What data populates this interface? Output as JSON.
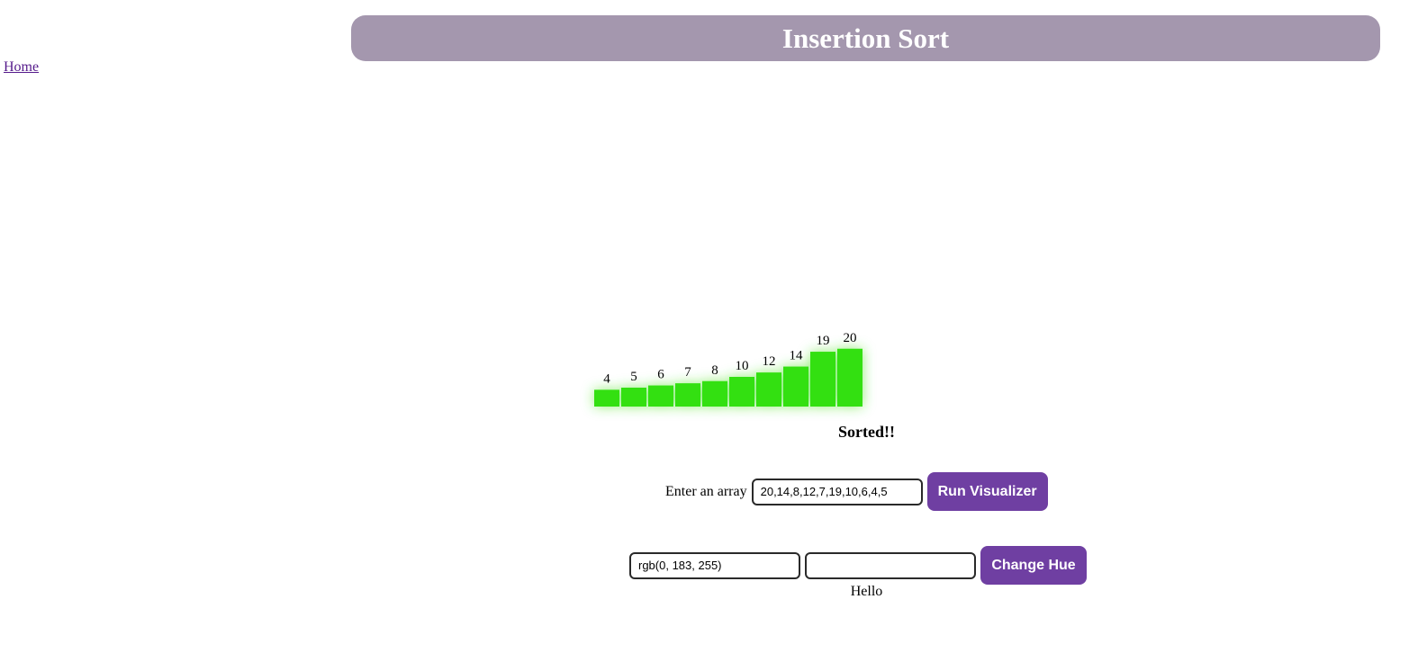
{
  "header": {
    "title": "Insertion Sort"
  },
  "nav": {
    "home_label": "Home"
  },
  "chart_data": {
    "type": "bar",
    "categories": [
      "4",
      "5",
      "6",
      "7",
      "8",
      "10",
      "12",
      "14",
      "19",
      "20"
    ],
    "values": [
      4,
      5,
      6,
      7,
      8,
      10,
      12,
      14,
      19,
      20
    ],
    "bar_color": "#33e011",
    "glow_color": "#33e011"
  },
  "status": {
    "text": "Sorted!!"
  },
  "array_form": {
    "label": "Enter an array",
    "input_value": "20,14,8,12,7,19,10,6,4,5",
    "run_button_label": "Run Visualizer"
  },
  "hue_form": {
    "color_input_value": "rgb(0, 183, 255)",
    "second_input_value": "",
    "change_button_label": "Change Hue",
    "caption": "Hello"
  },
  "colors": {
    "header_bg": "#a497ae",
    "button_bg": "#6f3fa2",
    "link": "#551a8b"
  }
}
